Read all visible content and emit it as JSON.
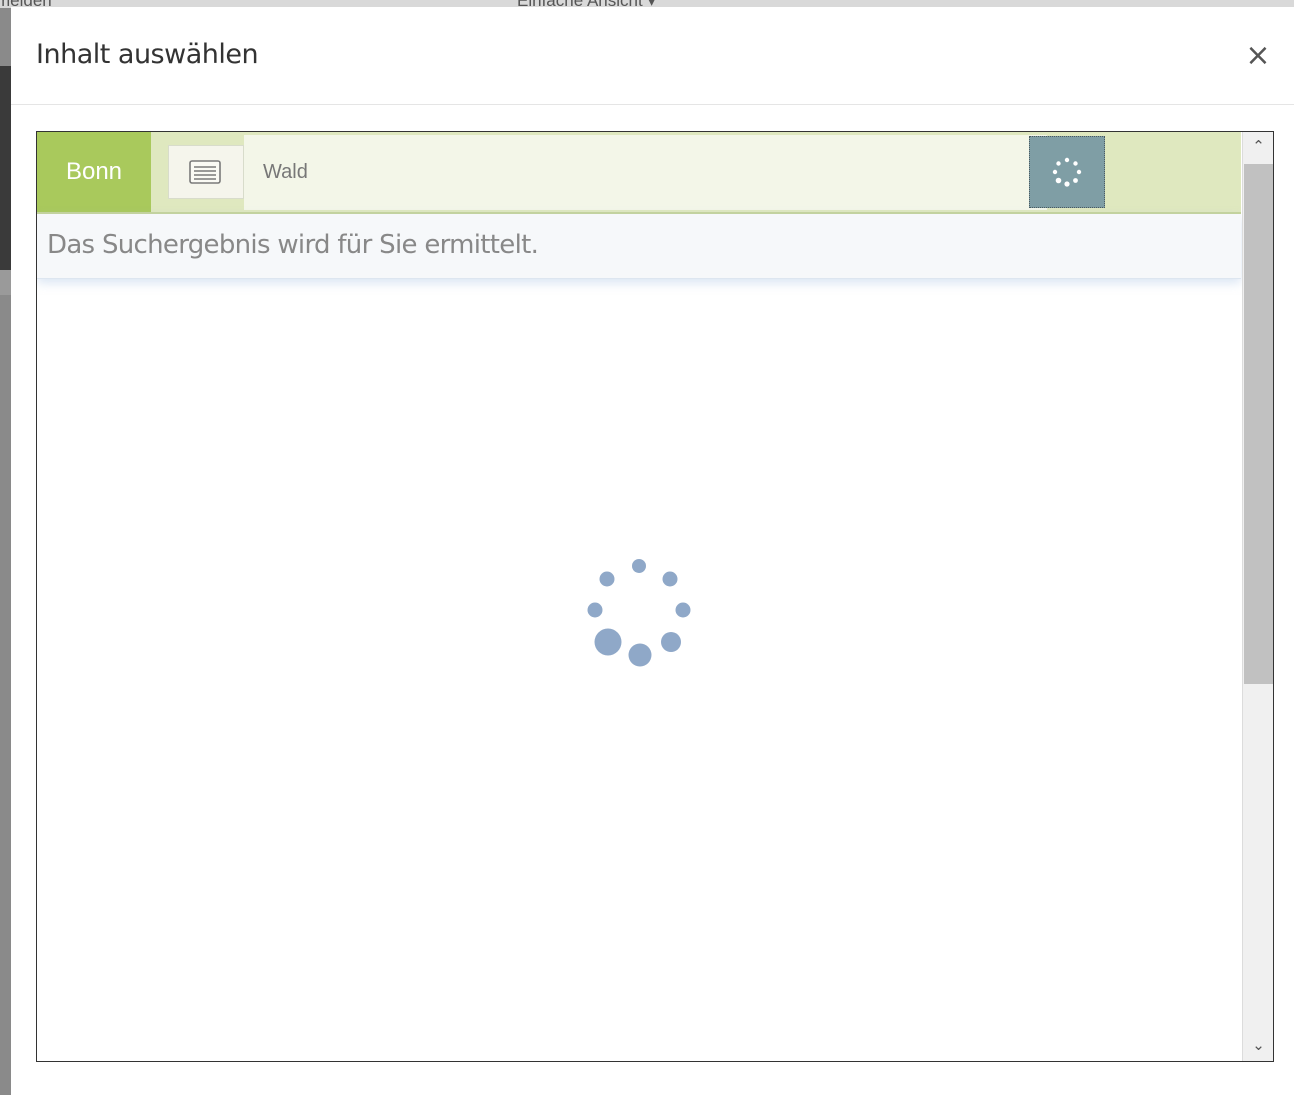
{
  "background": {
    "left_text": "melden",
    "center_text": "Einfache Ansicht ▾"
  },
  "modal": {
    "title": "Inhalt auswählen",
    "close_glyph": "×"
  },
  "search": {
    "location_tag": "Bonn",
    "list_icon": "list-icon",
    "query": "Wald",
    "button_icon": "spinner-icon"
  },
  "status": {
    "message": "Das Suchergebnis wird für Sie ermittelt."
  },
  "scrollbar": {
    "up_glyph": "⌃",
    "down_glyph": "⌄"
  },
  "colors": {
    "tag_green": "#a9c95c",
    "search_bar_bg": "#dfe8bf",
    "search_button": "#7f9ea5",
    "spinner_dots": "#8fa8c8"
  }
}
